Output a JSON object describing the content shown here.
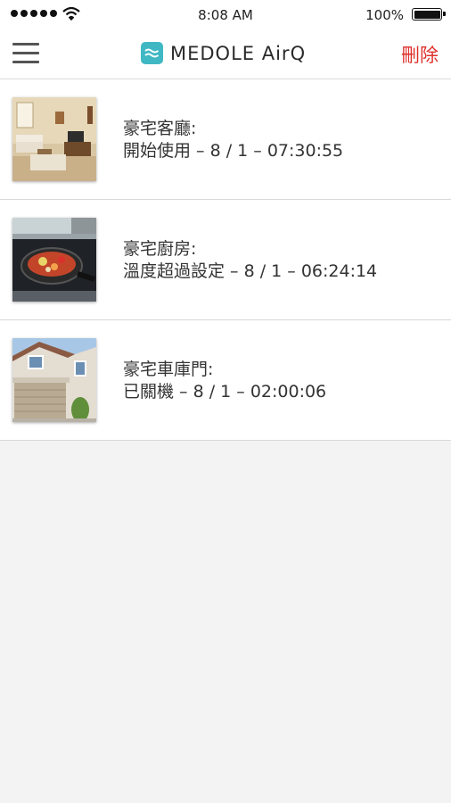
{
  "status_bar": {
    "time": "8:08 AM",
    "battery": "100%"
  },
  "header": {
    "brand": "MEDOLE AirQ",
    "delete_label": "刪除"
  },
  "events": [
    {
      "name": "豪宅客廳:",
      "detail": "開始使用 – 8 / 1 –  07:30:55",
      "thumbnail": "living-room-photo"
    },
    {
      "name": "豪宅廚房:",
      "detail": "溫度超過設定 – 8 / 1 –  06:24:14",
      "thumbnail": "kitchen-stove-photo"
    },
    {
      "name": "豪宅車庫門:",
      "detail": "已關機 – 8 / 1 –  02:00:06",
      "thumbnail": "garage-door-photo"
    }
  ],
  "colors": {
    "accent_red": "#e0302b",
    "logo_teal": "#3fb8c4"
  }
}
